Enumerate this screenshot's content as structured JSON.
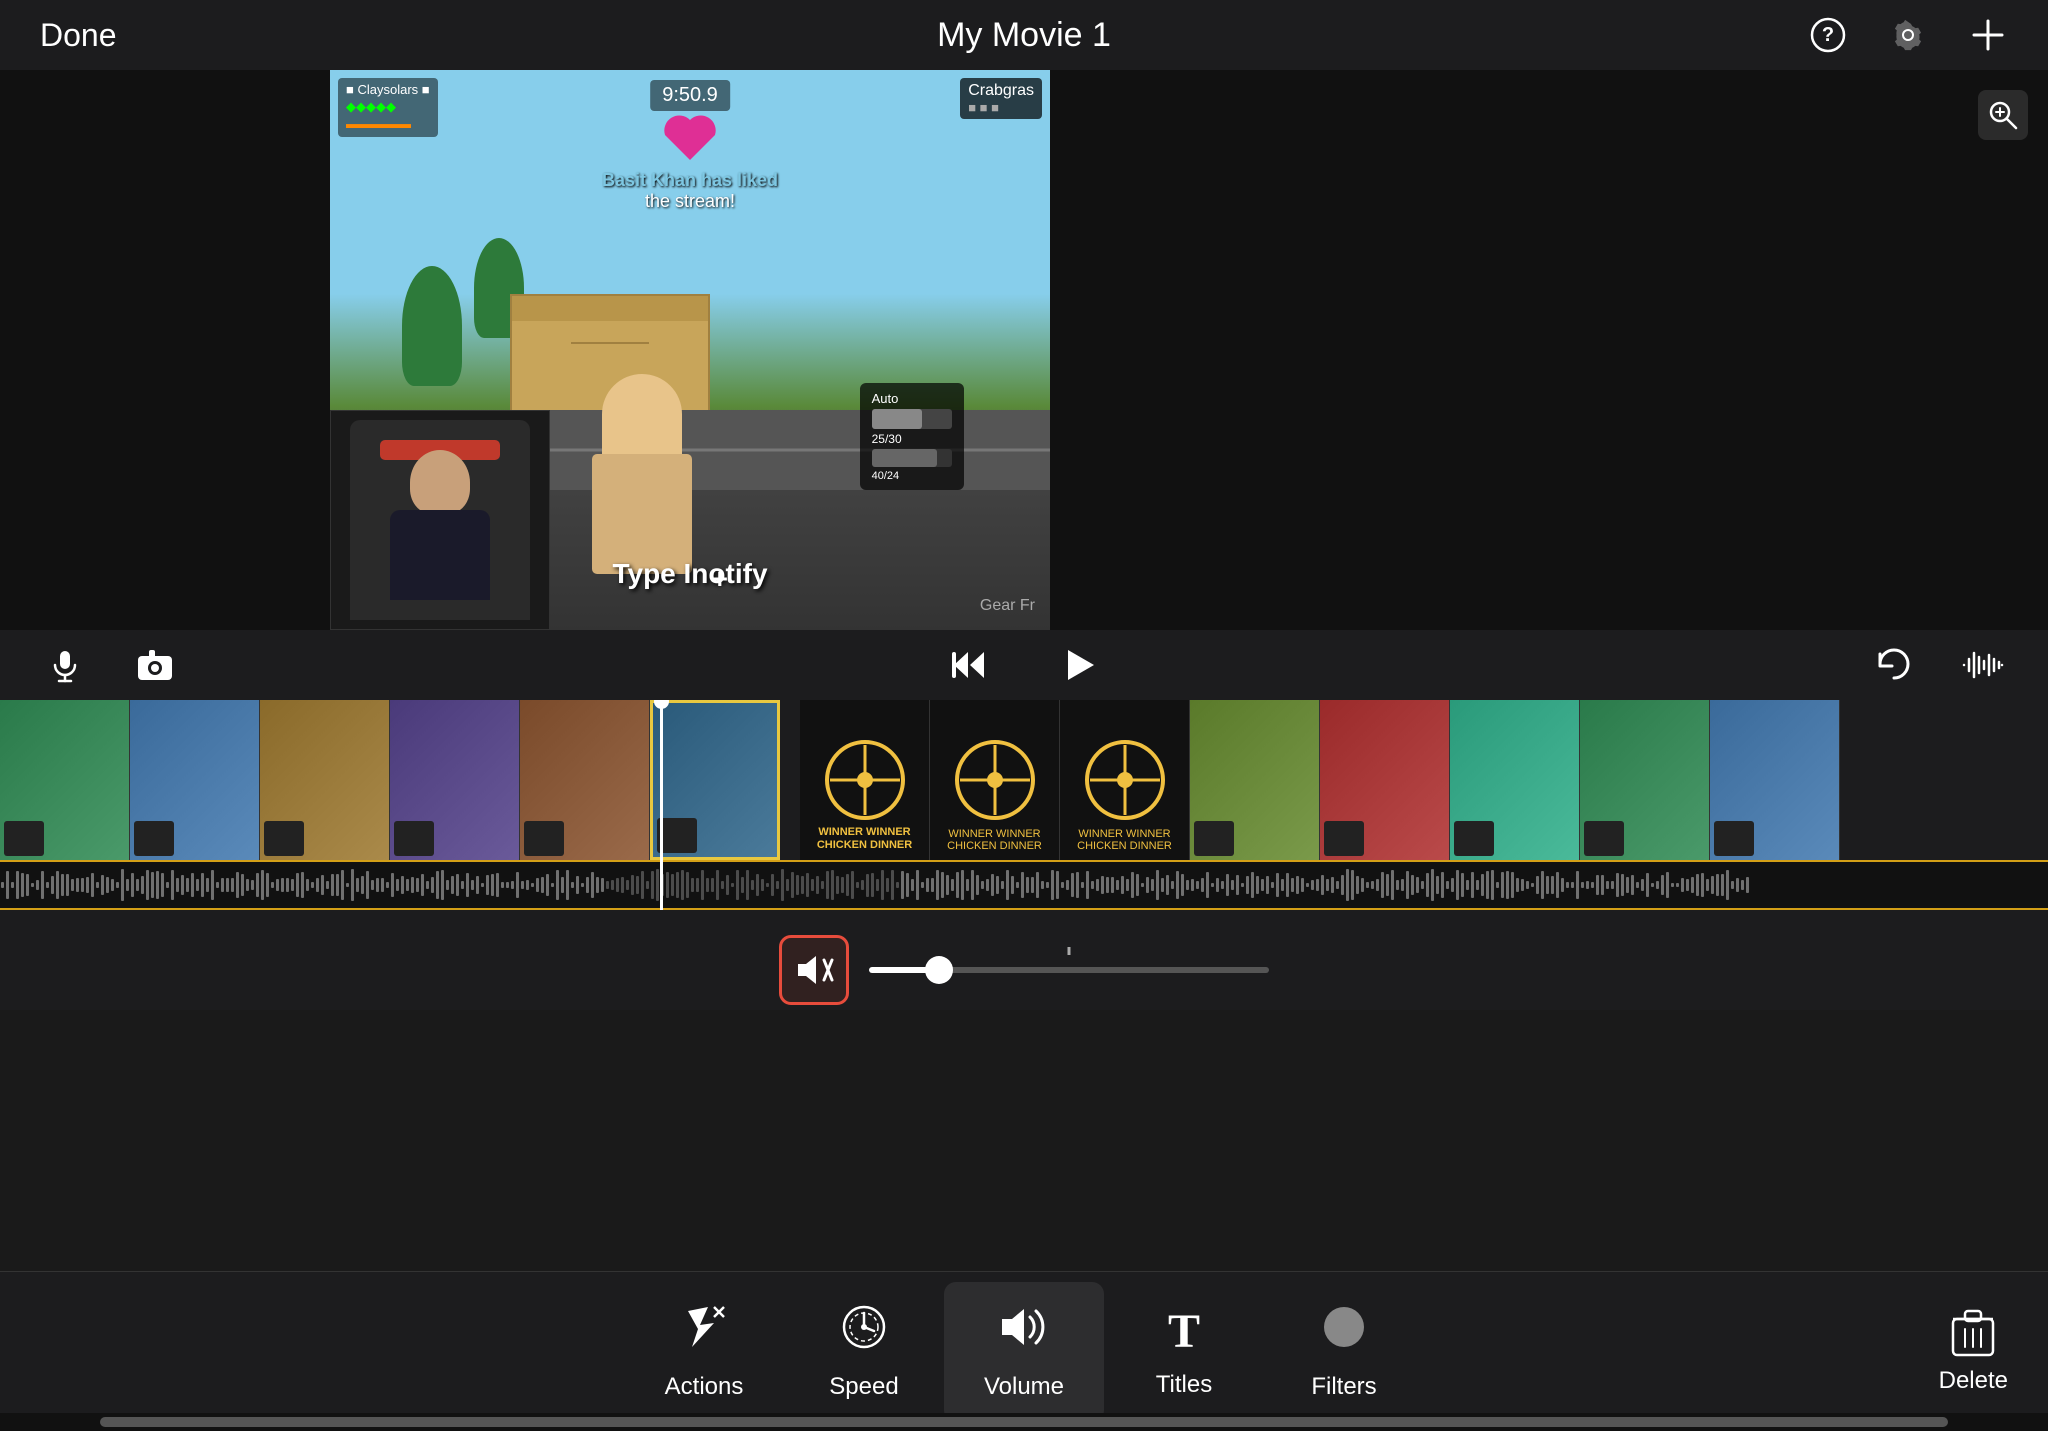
{
  "header": {
    "done_label": "Done",
    "title": "My Movie 1",
    "help_icon": "?",
    "settings_icon": "⚙",
    "add_icon": "+"
  },
  "preview": {
    "game_timer": "9:50.9",
    "notification_text": "has liked",
    "notification_text2": "the stream!",
    "notification_user": "Basit Khan",
    "corner_label": "Crabgras",
    "game_action_text": "Type Inotify",
    "zoom_icon": "🔍"
  },
  "controls": {
    "mic_icon": "🎙",
    "camera_icon": "📷",
    "skip_back_icon": "⏮",
    "play_icon": "▶",
    "undo_icon": "↩",
    "waveform_icon": "〰"
  },
  "volume": {
    "mute_icon": "🔇",
    "slider_value": 15,
    "slider_max": 100
  },
  "toolbar": {
    "actions_label": "Actions",
    "actions_icon": "✂",
    "speed_label": "Speed",
    "speed_icon": "⏱",
    "volume_label": "Volume",
    "volume_icon": "🔊",
    "titles_label": "Titles",
    "titles_icon": "T",
    "filters_label": "Filters",
    "filters_icon": "●",
    "delete_label": "Delete",
    "delete_icon": "🗑"
  },
  "timeline": {
    "clips": [
      {
        "id": 1,
        "class": "thumb-1"
      },
      {
        "id": 2,
        "class": "thumb-2"
      },
      {
        "id": 3,
        "class": "thumb-3"
      },
      {
        "id": 4,
        "class": "thumb-4"
      },
      {
        "id": 5,
        "class": "thumb-5"
      },
      {
        "id": 6,
        "class": "thumb-6"
      },
      {
        "id": 7,
        "class": "thumb-winner"
      },
      {
        "id": 8,
        "class": "thumb-winner"
      },
      {
        "id": 9,
        "class": "thumb-winner"
      },
      {
        "id": 10,
        "class": "thumb-7"
      },
      {
        "id": 11,
        "class": "thumb-8"
      },
      {
        "id": 12,
        "class": "thumb-9"
      }
    ],
    "winner_text_1": "WINNER WINNER",
    "winner_text_2": "CHICKEN DINNER"
  }
}
